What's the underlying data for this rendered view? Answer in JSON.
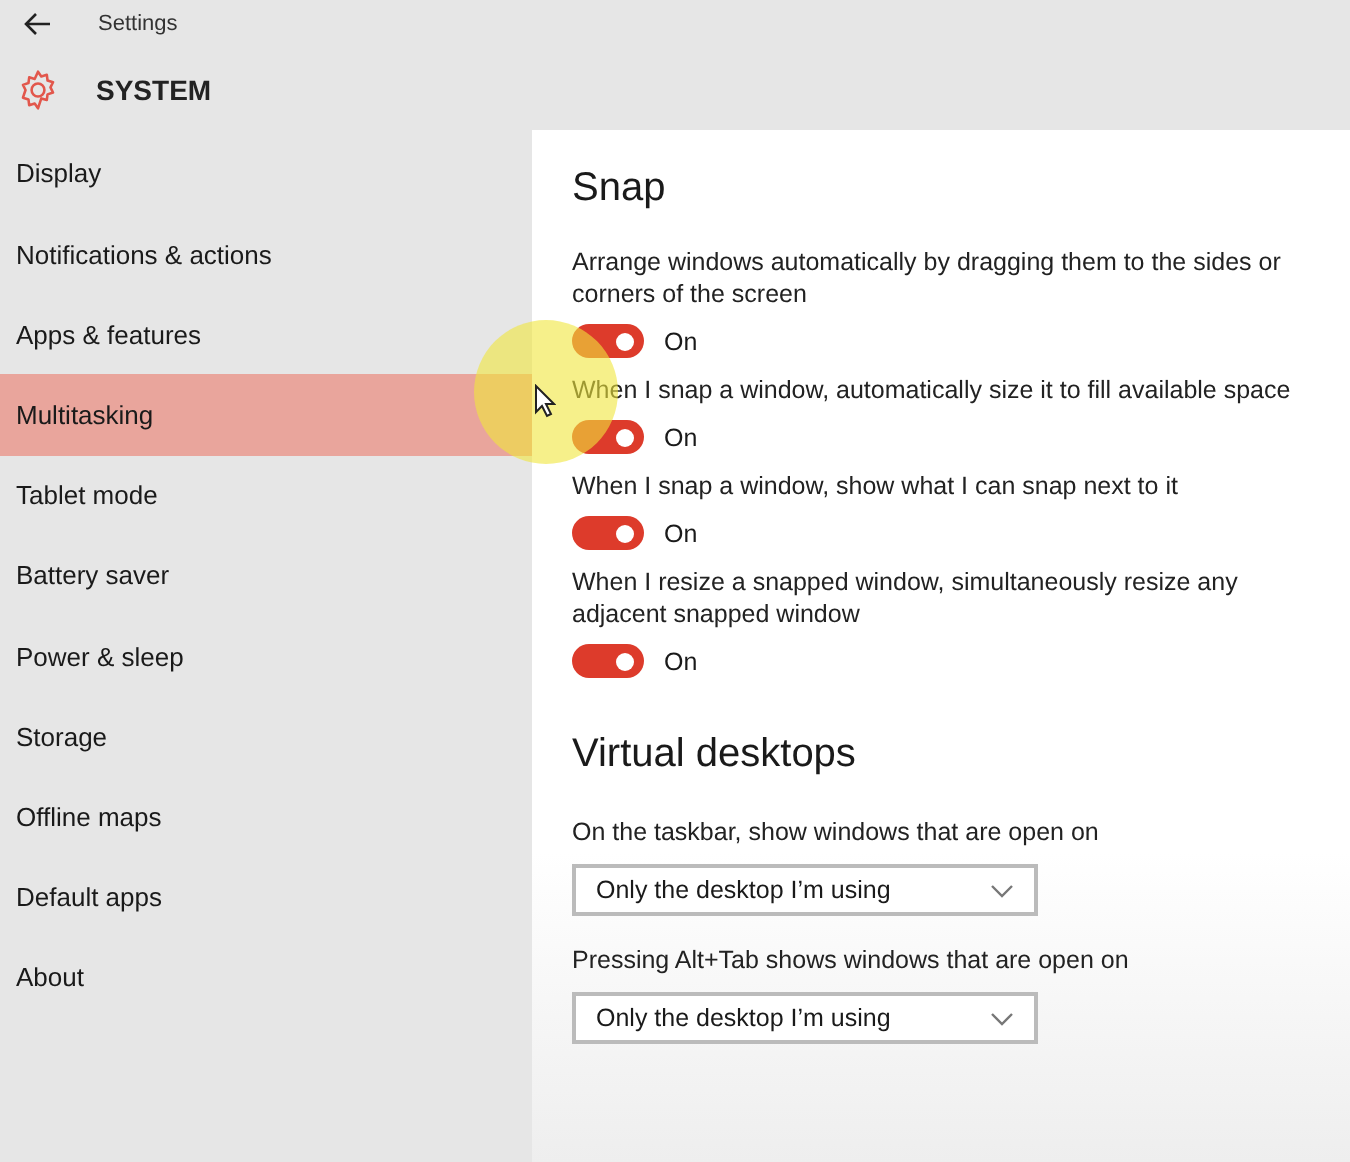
{
  "window": {
    "title": "Settings"
  },
  "header": {
    "title": "SYSTEM"
  },
  "sidebar": {
    "items": [
      {
        "label": "Display",
        "selected": false
      },
      {
        "label": "Notifications & actions",
        "selected": false
      },
      {
        "label": "Apps & features",
        "selected": false
      },
      {
        "label": "Multitasking",
        "selected": true
      },
      {
        "label": "Tablet mode",
        "selected": false
      },
      {
        "label": "Battery saver",
        "selected": false
      },
      {
        "label": "Power & sleep",
        "selected": false
      },
      {
        "label": "Storage",
        "selected": false
      },
      {
        "label": "Offline maps",
        "selected": false
      },
      {
        "label": "Default apps",
        "selected": false
      },
      {
        "label": "About",
        "selected": false
      }
    ]
  },
  "sections": [
    {
      "title": "Snap",
      "settings": [
        {
          "kind": "toggle",
          "label": "Arrange windows automatically by dragging them to the sides or corners of the screen",
          "on": true,
          "state_text": "On"
        },
        {
          "kind": "toggle",
          "label": "When I snap a window, automatically size it to fill available space",
          "on": true,
          "state_text": "On"
        },
        {
          "kind": "toggle",
          "label": "When I snap a window, show what I can snap next to it",
          "on": true,
          "state_text": "On"
        },
        {
          "kind": "toggle",
          "label": "When I resize a snapped window, simultaneously resize any adjacent snapped window",
          "on": true,
          "state_text": "On"
        }
      ]
    },
    {
      "title": "Virtual desktops",
      "settings": [
        {
          "kind": "dropdown",
          "label": "On the taskbar, show windows that are open on",
          "value": "Only the desktop I’m using"
        },
        {
          "kind": "dropdown",
          "label": "Pressing Alt+Tab shows windows that are open on",
          "value": "Only the desktop I’m using"
        }
      ]
    }
  ]
}
